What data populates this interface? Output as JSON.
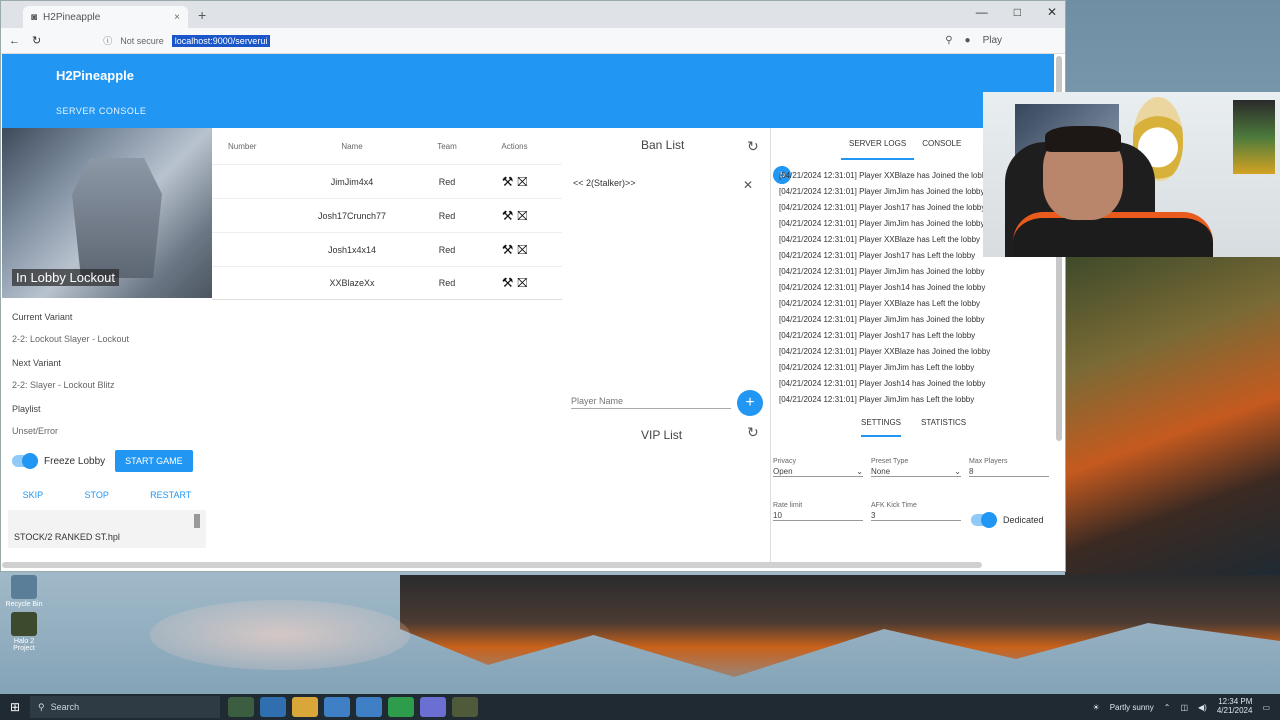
{
  "browser": {
    "tab_title": "H2Pineapple",
    "tab_close": "×",
    "new_tab": "+",
    "window_controls": [
      "—",
      "□",
      "✕"
    ],
    "addr_prefix": "Not secure",
    "url": "localhost:9000/serverui",
    "profile_label": "Play"
  },
  "app": {
    "title": "H2Pineapple",
    "subtitle": "SERVER CONSOLE"
  },
  "left": {
    "map_label": "In Lobby Lockout",
    "current_variant_label": "Current Variant",
    "current_variant_value": "2-2: Lockout Slayer - Lockout",
    "next_variant_label": "Next Variant",
    "next_variant_value": "2-2: Slayer - Lockout Blitz",
    "playlist_label": "Playlist",
    "playlist_value": "Unset/Error",
    "freeze_lobby_label": "Freeze Lobby",
    "start_game_label": "START GAME",
    "controls": [
      "SKIP",
      "STOP",
      "RESTART"
    ],
    "log_file": "STOCK/2 RANKED ST.hpl"
  },
  "players": {
    "headers": [
      "Number",
      "Name",
      "Team",
      "Actions"
    ],
    "rows": [
      {
        "number": "",
        "name": "JimJim4x4",
        "team": "Red"
      },
      {
        "number": "",
        "name": "Josh17Crunch77",
        "team": "Red"
      },
      {
        "number": "",
        "name": "Josh1x4x14",
        "team": "Red"
      },
      {
        "number": "",
        "name": "XXBlazeXx",
        "team": "Red"
      }
    ]
  },
  "lists": {
    "ban_title": "Ban List",
    "ban_items": [
      "<< 2(Stalker)>>"
    ],
    "player_placeholder": "Player Name",
    "vip_title": "VIP List"
  },
  "right": {
    "tabs": [
      "SERVER LOGS",
      "CONSOLE"
    ],
    "events_badge": "↻",
    "events": [
      "[04/21/2024 12:31:01] Player XXBlaze has Joined the lobby",
      "[04/21/2024 12:31:01] Player JimJim has Joined the lobby",
      "[04/21/2024 12:31:01] Player Josh17 has Joined the lobby",
      "[04/21/2024 12:31:01] Player JimJim has Joined the lobby",
      "[04/21/2024 12:31:01] Player XXBlaze has Left the lobby",
      "[04/21/2024 12:31:01] Player Josh17 has Left the lobby",
      "[04/21/2024 12:31:01] Player JimJim has Joined the lobby",
      "[04/21/2024 12:31:01] Player Josh14 has Joined the lobby",
      "[04/21/2024 12:31:01] Player XXBlaze has Left the lobby",
      "[04/21/2024 12:31:01] Player JimJim has Joined the lobby",
      "[04/21/2024 12:31:01] Player Josh17 has Left the lobby",
      "[04/21/2024 12:31:01] Player XXBlaze has Joined the lobby",
      "[04/21/2024 12:31:01] Player JimJim has Left the lobby",
      "[04/21/2024 12:31:01] Player Josh14 has Joined the lobby",
      "[04/21/2024 12:31:01] Player JimJim has Left the lobby"
    ],
    "bottom_tabs": [
      "SETTINGS",
      "STATISTICS"
    ],
    "privacy_label": "Privacy",
    "privacy_value": "Open",
    "preset_label": "Preset Type",
    "preset_value": "None",
    "max_players_label": "Max Players",
    "max_players_value": "8",
    "ratelimit_label": "Rate limit",
    "ratelimit_value": "10",
    "afk_label": "AFK Kick Time",
    "afk_value": "3",
    "dedicated_label": "Dedicated"
  },
  "desktop": {
    "icons": [
      "Recycle Bin",
      "Halo 2 Project"
    ]
  },
  "taskbar": {
    "search_placeholder": "Search",
    "weather": "Partly sunny",
    "time": "12:34 PM",
    "date": "4/21/2024"
  }
}
